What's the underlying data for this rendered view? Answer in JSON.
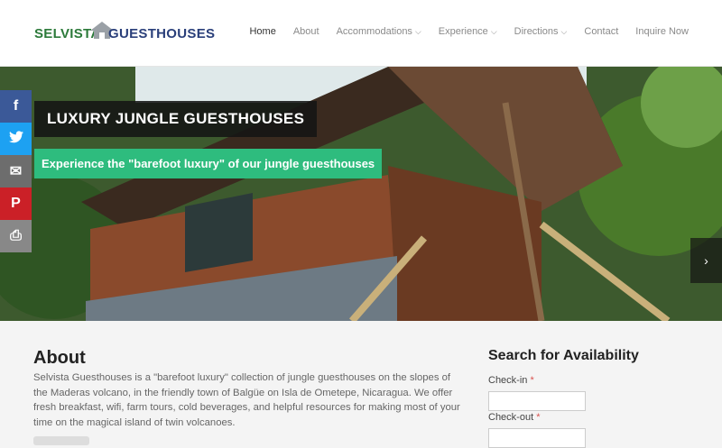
{
  "header": {
    "logo": {
      "word1": "SELVISTA",
      "word2": "GUESTHOUSES"
    },
    "nav": [
      {
        "label": "Home",
        "active": true,
        "dropdown": false
      },
      {
        "label": "About",
        "active": false,
        "dropdown": false
      },
      {
        "label": "Accommodations",
        "active": false,
        "dropdown": true
      },
      {
        "label": "Experience",
        "active": false,
        "dropdown": true
      },
      {
        "label": "Directions",
        "active": false,
        "dropdown": true
      },
      {
        "label": "Contact",
        "active": false,
        "dropdown": false
      },
      {
        "label": "Inquire Now",
        "active": false,
        "dropdown": false
      }
    ]
  },
  "hero": {
    "title": "LUXURY JUNGLE GUESTHOUSES",
    "subtitle": "Experience the \"barefoot luxury\" of our jungle guesthouses",
    "next_icon": "chevron-right-icon"
  },
  "share": [
    {
      "icon": "facebook-icon",
      "glyph": "f",
      "color": "#3b5998"
    },
    {
      "icon": "twitter-icon",
      "glyph": "t",
      "color": "#1da1f2"
    },
    {
      "icon": "email-icon",
      "glyph": "✉",
      "color": "#6d6d6d"
    },
    {
      "icon": "pinterest-icon",
      "glyph": "P",
      "color": "#cb2027"
    },
    {
      "icon": "print-icon",
      "glyph": "⎙",
      "color": "#888888"
    }
  ],
  "about": {
    "heading": "About",
    "text": "Selvista Guesthouses is a \"barefoot luxury\" collection of jungle guesthouses on the slopes of the Maderas volcano, in the friendly town of Balgüe on Isla de Ometepe, Nicaragua. We offer fresh breakfast, wifi, farm tours, cold beverages, and helpful resources for making most of your time on the magical island of twin volcanoes."
  },
  "search": {
    "heading": "Search for Availability",
    "checkin_label": "Check-in",
    "checkout_label": "Check-out",
    "required_mark": "*",
    "checkin_value": "",
    "checkout_value": ""
  },
  "colors": {
    "accent_green": "#2ebc7e",
    "logo_green": "#2c7a3a",
    "logo_blue": "#2a3f7a"
  }
}
